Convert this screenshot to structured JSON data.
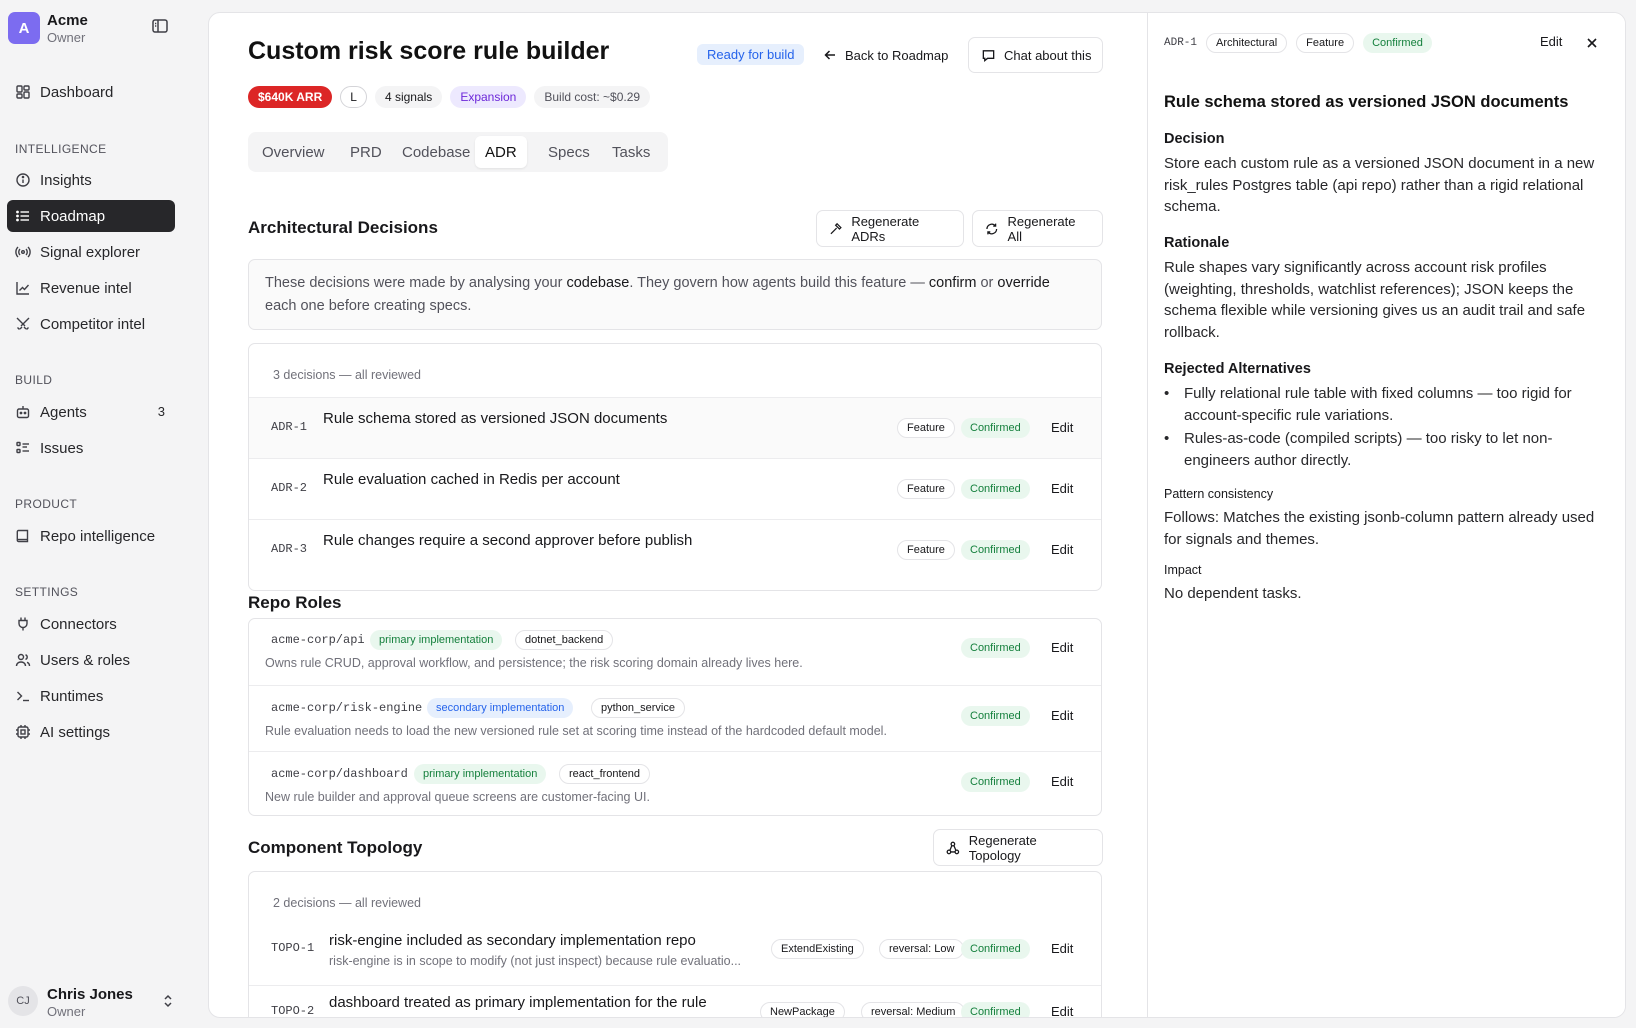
{
  "workspace": {
    "initial": "A",
    "name": "Acme",
    "role": "Owner"
  },
  "nav": {
    "dashboard": "Dashboard",
    "intelligence_label": "INTELLIGENCE",
    "insights": "Insights",
    "roadmap": "Roadmap",
    "signal_explorer": "Signal explorer",
    "revenue_intel": "Revenue intel",
    "competitor_intel": "Competitor intel",
    "build_label": "BUILD",
    "agents": "Agents",
    "agents_count": "3",
    "issues": "Issues",
    "product_label": "PRODUCT",
    "repo_intelligence": "Repo intelligence",
    "settings_label": "SETTINGS",
    "connectors": "Connectors",
    "users_roles": "Users & roles",
    "runtimes": "Runtimes",
    "ai_settings": "AI settings"
  },
  "user": {
    "initials": "CJ",
    "name": "Chris Jones",
    "role": "Owner"
  },
  "page": {
    "title": "Custom risk score rule builder",
    "status": "Ready for build",
    "back_label": "Back to Roadmap",
    "chat_label": "Chat about this",
    "tags": {
      "arr": "$640K ARR",
      "size": "L",
      "signals": "4 signals",
      "category": "Expansion",
      "cost": "Build cost: ~$0.29"
    },
    "tabs": [
      "Overview",
      "PRD",
      "Codebase",
      "ADR",
      "Specs",
      "Tasks"
    ],
    "active_tab": "ADR"
  },
  "adr": {
    "heading": "Architectural Decisions",
    "regen_adrs": "Regenerate ADRs",
    "regen_all": "Regenerate All",
    "notice": {
      "p1": "These decisions were made by analysing your ",
      "k1": "codebase",
      "p2": ". They govern how agents build this feature — ",
      "k2": "confirm",
      "p3": " or ",
      "k3": "override",
      "p4": " each one before creating specs."
    },
    "summary": "3 decisions — all reviewed",
    "items": [
      {
        "id": "ADR-1",
        "title": "Rule schema stored as versioned JSON documents",
        "type": "Feature",
        "status": "Confirmed",
        "edit": "Edit"
      },
      {
        "id": "ADR-2",
        "title": "Rule evaluation cached in Redis per account",
        "type": "Feature",
        "status": "Confirmed",
        "edit": "Edit"
      },
      {
        "id": "ADR-3",
        "title": "Rule changes require a second approver before publish",
        "type": "Feature",
        "status": "Confirmed",
        "edit": "Edit"
      }
    ]
  },
  "repo_roles": {
    "heading": "Repo Roles",
    "items": [
      {
        "repo": "acme-corp/api",
        "role": "primary implementation",
        "stack": "dotnet_backend",
        "desc": "Owns rule CRUD, approval workflow, and persistence; the risk scoring domain already lives here.",
        "status": "Confirmed",
        "edit": "Edit"
      },
      {
        "repo": "acme-corp/risk-engine",
        "role": "secondary implementation",
        "stack": "python_service",
        "desc": "Rule evaluation needs to load the new versioned rule set at scoring time instead of the hardcoded default model.",
        "status": "Confirmed",
        "edit": "Edit"
      },
      {
        "repo": "acme-corp/dashboard",
        "role": "primary implementation",
        "stack": "react_frontend",
        "desc": "New rule builder and approval queue screens are customer-facing UI.",
        "status": "Confirmed",
        "edit": "Edit"
      }
    ]
  },
  "topology": {
    "heading": "Component Topology",
    "regen": "Regenerate Topology",
    "summary": "2 decisions — all reviewed",
    "items": [
      {
        "id": "TOPO-1",
        "title": "risk-engine included as secondary implementation repo",
        "desc": "risk-engine is in scope to modify (not just inspect) because rule evaluatio...",
        "kind": "ExtendExisting",
        "reversal": "reversal: Low",
        "status": "Confirmed",
        "edit": "Edit"
      },
      {
        "id": "TOPO-2",
        "title": "dashboard treated as primary implementation for the rule",
        "desc": "",
        "kind": "NewPackage",
        "reversal": "reversal: Medium",
        "status": "Confirmed",
        "edit": "Edit"
      }
    ]
  },
  "detail": {
    "id": "ADR-1",
    "category": "Architectural",
    "type": "Feature",
    "status": "Confirmed",
    "edit": "Edit",
    "title": "Rule schema stored as versioned JSON documents",
    "decision_label": "Decision",
    "decision": "Store each custom rule as a versioned JSON document in a new risk_rules Postgres table (api repo) rather than a rigid relational schema.",
    "rationale_label": "Rationale",
    "rationale": "Rule shapes vary significantly across account risk profiles (weighting, thresholds, watchlist references); JSON keeps the schema flexible while versioning gives us an audit trail and safe rollback.",
    "rejected_label": "Rejected Alternatives",
    "rejected": [
      "Fully relational rule table with fixed columns — too rigid for account-specific rule variations.",
      "Rules-as-code (compiled scripts) — too risky to let non-engineers author directly."
    ],
    "pattern_label": "Pattern consistency",
    "pattern": "Follows: Matches the existing jsonb-column pattern already used for signals and themes.",
    "impact_label": "Impact",
    "impact": "No dependent tasks."
  }
}
